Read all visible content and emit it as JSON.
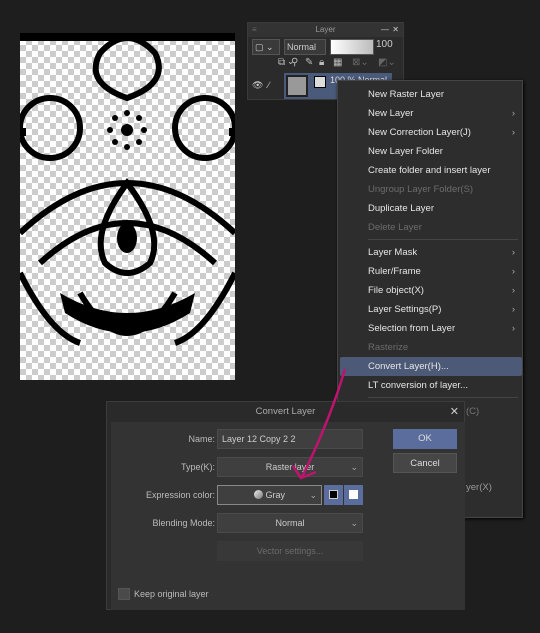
{
  "layer_panel": {
    "title": "Layer",
    "blend_mode": "Normal",
    "opacity": "100",
    "layer_info": "100 % Normal"
  },
  "context_menu": {
    "items": [
      {
        "label": "New Raster Layer",
        "enabled": true,
        "submenu": false
      },
      {
        "label": "New Layer",
        "enabled": true,
        "submenu": true
      },
      {
        "label": "New Correction Layer(J)",
        "enabled": true,
        "submenu": true
      },
      {
        "label": "New Layer Folder",
        "enabled": true,
        "submenu": false
      },
      {
        "label": "Create folder and insert layer",
        "enabled": true,
        "submenu": false
      },
      {
        "label": "Ungroup Layer Folder(S)",
        "enabled": false,
        "submenu": false
      },
      {
        "label": "Duplicate Layer",
        "enabled": true,
        "submenu": false
      },
      {
        "label": "Delete Layer",
        "enabled": false,
        "submenu": false
      },
      {
        "label": "Layer Mask",
        "enabled": true,
        "submenu": true
      },
      {
        "label": "Ruler/Frame",
        "enabled": true,
        "submenu": true
      },
      {
        "label": "File object(X)",
        "enabled": true,
        "submenu": true
      },
      {
        "label": "Layer Settings(P)",
        "enabled": true,
        "submenu": true
      },
      {
        "label": "Selection from Layer",
        "enabled": true,
        "submenu": true
      },
      {
        "label": "Rasterize",
        "enabled": false,
        "submenu": false
      },
      {
        "label": "Convert Layer(H)...",
        "enabled": true,
        "submenu": false,
        "selected": true
      },
      {
        "label": "LT conversion of layer...",
        "enabled": true,
        "submenu": false
      }
    ],
    "partial_1": "(C)",
    "partial_2": "yer(X)"
  },
  "dialog": {
    "title": "Convert Layer",
    "name_label": "Name:",
    "name_value": "Layer 12 Copy 2 2",
    "type_label": "Type(K):",
    "type_value": "Raster layer",
    "expr_label": "Expression color:",
    "expr_value": "Gray",
    "blend_label": "Blending Mode:",
    "blend_value": "Normal",
    "vector_settings": "Vector settings...",
    "keep_original": "Keep original layer",
    "keep_original_checked": false,
    "ok": "OK",
    "cancel": "Cancel"
  },
  "colors": {
    "accent": "#5b6d9c",
    "annotation_arrow": "#c0136e"
  }
}
